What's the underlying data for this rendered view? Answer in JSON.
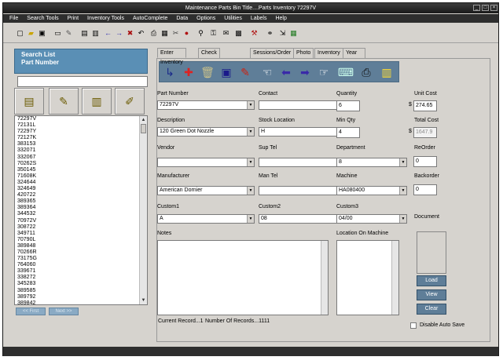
{
  "window": {
    "title": "Maintenance Parts Bin    Title....Parts Inventory    72297V"
  },
  "menu": [
    "File",
    "Search Tools",
    "Print",
    "Inventory Tools",
    "AutoComplete",
    "Data",
    "Options",
    "Utilities",
    "Labels",
    "Help"
  ],
  "search": {
    "title_line1": "Search List",
    "title_line2": "Part Number",
    "input_value": "",
    "items": [
      "72297V",
      "72131L",
      "72297Y",
      "72127K",
      "383153",
      "332071",
      "332067",
      "70262S",
      "350145",
      "71608K",
      "324644",
      "324649",
      "420722",
      "389365",
      "389364",
      "344532",
      "70972V",
      "308722",
      "349711",
      "70790L",
      "389848",
      "70266R",
      "73175G",
      "764060",
      "339671",
      "338272",
      "345283",
      "389585",
      "389792",
      "389842"
    ],
    "first_label": "<< First",
    "next_label": "Next >>"
  },
  "tabs": [
    "Enter Inventory",
    "Check Parts In/Out",
    "Sessions/Order",
    "Photo",
    "Inventory",
    "Year Charts"
  ],
  "form": {
    "part_number_label": "Part Number",
    "part_number": "72297V",
    "contact_label": "Contact",
    "contact": "",
    "quantity_label": "Quantity",
    "quantity": "6",
    "unit_cost_label": "Unit Cost",
    "unit_cost": "274.65",
    "description_label": "Description",
    "description": "120 Green Dot Nozzle",
    "stock_location_label": "Stock Location",
    "stock_location": "H",
    "min_qty_label": "Min Qty",
    "min_qty": "4",
    "total_cost_label": "Total Cost",
    "total_cost": "1647.9",
    "vendor_label": "Vendor",
    "vendor": "",
    "sup_tel_label": "Sup Tel",
    "sup_tel": "",
    "department_label": "Department",
    "department": "8",
    "reorder_label": "ReOrder",
    "reorder": "0",
    "manufacturer_label": "Manufacturer",
    "manufacturer": "American Dornier",
    "man_tel_label": "Man Tel",
    "man_tel": "",
    "machine_label": "Machine",
    "machine": "HA080400",
    "backorder_label": "Backorder",
    "backorder": "0",
    "custom1_label": "Custom1",
    "custom1": "A",
    "custom2_label": "Custom2",
    "custom2": "08",
    "custom3_label": "Custom3",
    "custom3": "04/00",
    "document_label": "Document",
    "notes_label": "Notes",
    "location_label": "Location On Machine",
    "currency": "$"
  },
  "buttons": {
    "load": "Load",
    "view": "View",
    "clear": "Clear"
  },
  "autosave_label": "Disable Auto Save",
  "status": {
    "current_record": "Current Record...1",
    "num_records": "Number Of Records...1111"
  },
  "colors": {
    "accent": "#5f7e98",
    "search_header": "#5a8fb5",
    "titlebar": "#1a1a1a"
  }
}
